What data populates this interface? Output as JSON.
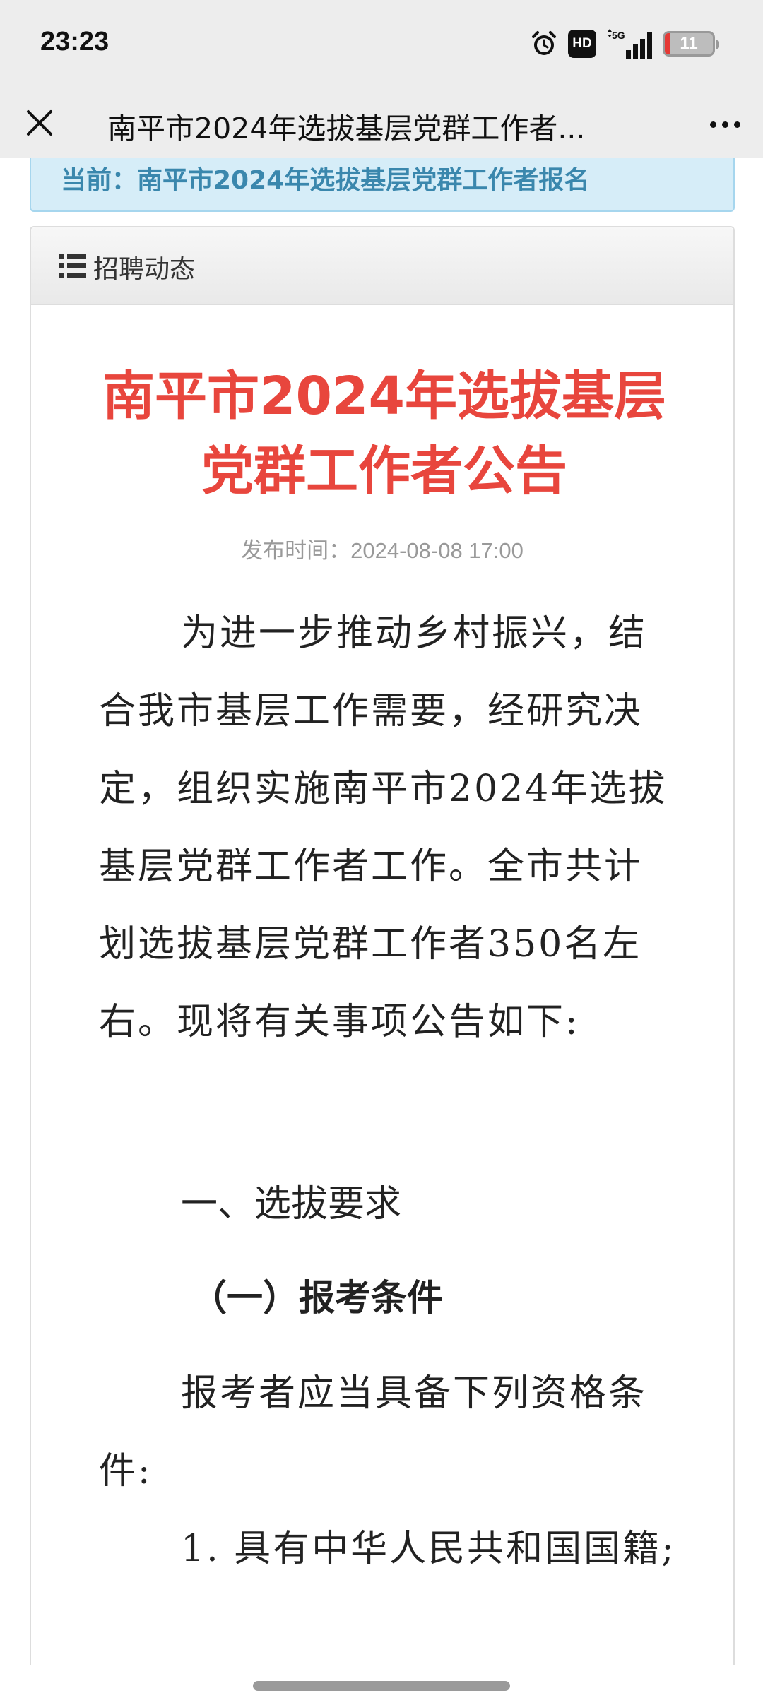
{
  "status_bar": {
    "time": "23:23",
    "hd_label": "HD",
    "network_label": "5G",
    "battery_level": "11",
    "battery_color": "#e53935"
  },
  "title_bar": {
    "close_icon": "close-icon",
    "title": "南平市2024年选拔基层党群工作者...",
    "more_icon": "more-dots-icon"
  },
  "breadcrumb": {
    "text": "当前：南平市2024年选拔基层党群工作者报名"
  },
  "panel": {
    "icon": "list-icon",
    "label": "招聘动态"
  },
  "article": {
    "title": "南平市2024年选拔基层党群工作者公告",
    "title_color": "#e8463d",
    "date": "发布时间：2024-08-08 17:00",
    "intro": "为进一步推动乡村振兴，结合我市基层工作需要，经研究决定，组织实施南平市2024年选拔基层党群工作者工作。全市共计划选拔基层党群工作者350名左右。现将有关事项公告如下:",
    "section_1": "一、选拔要求",
    "subsection_1": "（一）报考条件",
    "conditions_intro": "报考者应当具备下列资格条件:",
    "condition_1": "1. 具有中华人民共和国国籍;"
  }
}
